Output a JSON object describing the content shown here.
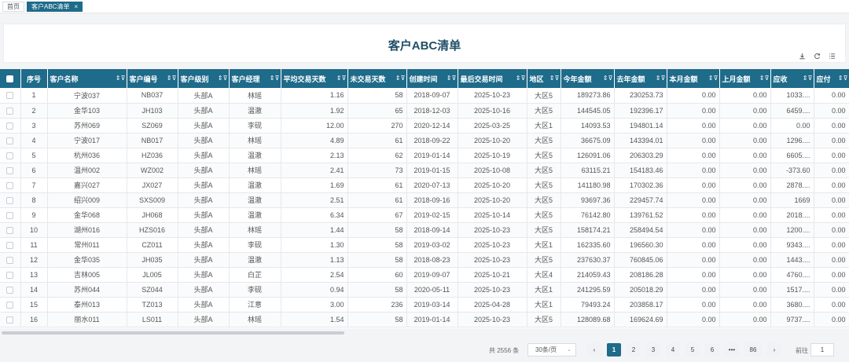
{
  "tabs": [
    {
      "label": "首页",
      "closable": false,
      "active": false
    },
    {
      "label": "客户ABC清单",
      "closable": true,
      "active": true
    }
  ],
  "page_title": "客户ABC清单",
  "toolbar": {
    "download_icon": "download-icon",
    "refresh_icon": "refresh-icon",
    "columns_icon": "column-settings-icon"
  },
  "colors": {
    "header_bg": "#1e6b8a",
    "title": "#1f4e66"
  },
  "table": {
    "columns": [
      "序号",
      "客户名称",
      "客户编号",
      "客户级别",
      "客户经理",
      "平均交易天数",
      "未交易天数",
      "创建时间",
      "最后交易时间",
      "地区",
      "今年金额",
      "去年金额",
      "本月金额",
      "上月金额",
      "应收",
      "应付"
    ],
    "rows": [
      [
        "1",
        "宁波037",
        "NB037",
        "头部A",
        "林瑶",
        "1.16",
        "58",
        "2018-09-07",
        "2025-10-23",
        "大区5",
        "189273.86",
        "230253.73",
        "0.00",
        "0.00",
        "1033....",
        "0.00"
      ],
      [
        "2",
        "金华103",
        "JH103",
        "头部A",
        "温澈",
        "1.92",
        "65",
        "2018-12-03",
        "2025-10-16",
        "大区5",
        "144545.05",
        "192396.17",
        "0.00",
        "0.00",
        "6459....",
        "0.00"
      ],
      [
        "3",
        "苏州069",
        "SZ069",
        "头部A",
        "李砚",
        "12.00",
        "270",
        "2020-12-14",
        "2025-03-25",
        "大区1",
        "14093.53",
        "194801.14",
        "0.00",
        "0.00",
        "0.00",
        "0.00"
      ],
      [
        "4",
        "宁波017",
        "NB017",
        "头部A",
        "林瑶",
        "4.89",
        "61",
        "2018-09-22",
        "2025-10-20",
        "大区5",
        "36675.09",
        "143394.01",
        "0.00",
        "0.00",
        "1296....",
        "0.00"
      ],
      [
        "5",
        "杭州036",
        "HZ036",
        "头部A",
        "温澈",
        "2.13",
        "62",
        "2019-01-14",
        "2025-10-19",
        "大区5",
        "126091.06",
        "206303.29",
        "0.00",
        "0.00",
        "6605....",
        "0.00"
      ],
      [
        "6",
        "温州002",
        "WZ002",
        "头部A",
        "林瑶",
        "2.41",
        "73",
        "2019-01-15",
        "2025-10-08",
        "大区5",
        "63115.21",
        "154183.46",
        "0.00",
        "0.00",
        "-373.60",
        "0.00"
      ],
      [
        "7",
        "嘉兴027",
        "JX027",
        "头部A",
        "温澈",
        "1.69",
        "61",
        "2020-07-13",
        "2025-10-20",
        "大区5",
        "141180.98",
        "170302.36",
        "0.00",
        "0.00",
        "2878....",
        "0.00"
      ],
      [
        "8",
        "绍兴009",
        "SXS009",
        "头部A",
        "温澈",
        "2.51",
        "61",
        "2018-09-16",
        "2025-10-20",
        "大区5",
        "93697.36",
        "229457.74",
        "0.00",
        "0.00",
        "1669",
        "0.00"
      ],
      [
        "9",
        "金华068",
        "JH068",
        "头部A",
        "温澈",
        "6.34",
        "67",
        "2019-02-15",
        "2025-10-14",
        "大区5",
        "76142.80",
        "139761.52",
        "0.00",
        "0.00",
        "2018....",
        "0.00"
      ],
      [
        "10",
        "湖州016",
        "HZS016",
        "头部A",
        "林瑶",
        "1.44",
        "58",
        "2018-09-14",
        "2025-10-23",
        "大区5",
        "158174.21",
        "258494.54",
        "0.00",
        "0.00",
        "1200....",
        "0.00"
      ],
      [
        "11",
        "常州011",
        "CZ011",
        "头部A",
        "李砚",
        "1.30",
        "58",
        "2019-03-02",
        "2025-10-23",
        "大区1",
        "162335.60",
        "196560.30",
        "0.00",
        "0.00",
        "9343....",
        "0.00"
      ],
      [
        "12",
        "金华035",
        "JH035",
        "头部A",
        "温澈",
        "1.13",
        "58",
        "2018-08-23",
        "2025-10-23",
        "大区5",
        "237630.37",
        "760845.06",
        "0.00",
        "0.00",
        "1443....",
        "0.00"
      ],
      [
        "13",
        "吉林005",
        "JL005",
        "头部A",
        "白芷",
        "2.54",
        "60",
        "2019-09-07",
        "2025-10-21",
        "大区4",
        "214059.43",
        "208186.28",
        "0.00",
        "0.00",
        "4760....",
        "0.00"
      ],
      [
        "14",
        "苏州044",
        "SZ044",
        "头部A",
        "李砚",
        "0.94",
        "58",
        "2020-05-11",
        "2025-10-23",
        "大区1",
        "241295.59",
        "205018.29",
        "0.00",
        "0.00",
        "1517....",
        "0.00"
      ],
      [
        "15",
        "泰州013",
        "TZ013",
        "头部A",
        "江意",
        "3.00",
        "236",
        "2019-03-14",
        "2025-04-28",
        "大区1",
        "79493.24",
        "203858.17",
        "0.00",
        "0.00",
        "3680....",
        "0.00"
      ],
      [
        "16",
        "丽水011",
        "LS011",
        "头部A",
        "林瑶",
        "1.54",
        "58",
        "2019-01-14",
        "2025-10-23",
        "大区5",
        "128089.68",
        "169624.69",
        "0.00",
        "0.00",
        "9737....",
        "0.00"
      ]
    ]
  },
  "pager": {
    "total": "共 2556 条",
    "page_size": "30条/页",
    "prev": "‹",
    "next": "›",
    "pages": [
      "1",
      "2",
      "3",
      "4",
      "5",
      "6",
      "•••",
      "86"
    ],
    "current": "1",
    "goto_label": "前往",
    "goto_value": "1"
  }
}
